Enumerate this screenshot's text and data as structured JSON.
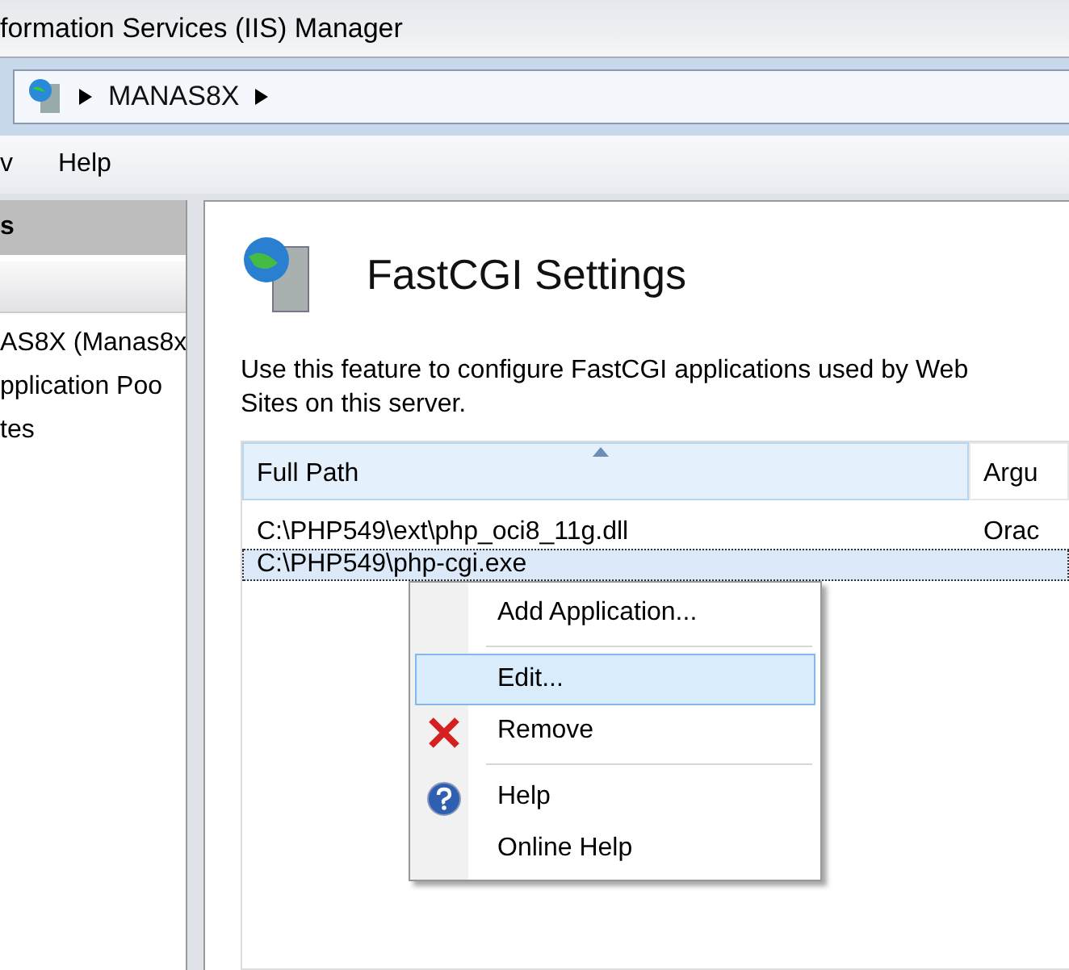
{
  "window": {
    "title": "formation Services (IIS) Manager"
  },
  "address_bar": {
    "crumbs": [
      "MANAS8X"
    ]
  },
  "menu_bar": [
    "v",
    "Help"
  ],
  "sidebar": {
    "header": "s",
    "items": [
      {
        "label": "AS8X (Manas8x",
        "selected": false
      },
      {
        "label": "pplication Poo",
        "selected": false
      },
      {
        "label": "tes",
        "selected": false
      }
    ]
  },
  "page": {
    "title": "FastCGI Settings",
    "description": "Use this feature to configure FastCGI applications used by Web Sites on this server.",
    "table": {
      "columns": [
        "Full Path",
        "Argu"
      ],
      "rows": [
        {
          "cells": [
            "C:\\PHP549\\ext\\php_oci8_11g.dll",
            "Orac"
          ],
          "selected": false
        },
        {
          "cells": [
            "C:\\PHP549\\php-cgi.exe",
            ""
          ],
          "selected": true
        }
      ]
    }
  },
  "context_menu": [
    {
      "kind": "item",
      "label": "Add Application...",
      "selected": false
    },
    {
      "kind": "separator"
    },
    {
      "kind": "item",
      "label": "Edit...",
      "selected": true
    },
    {
      "kind": "remove",
      "label": "Remove",
      "selected": false
    },
    {
      "kind": "separator"
    },
    {
      "kind": "help",
      "label": "Help",
      "selected": false
    },
    {
      "kind": "item",
      "label": "Online Help",
      "selected": false
    }
  ]
}
